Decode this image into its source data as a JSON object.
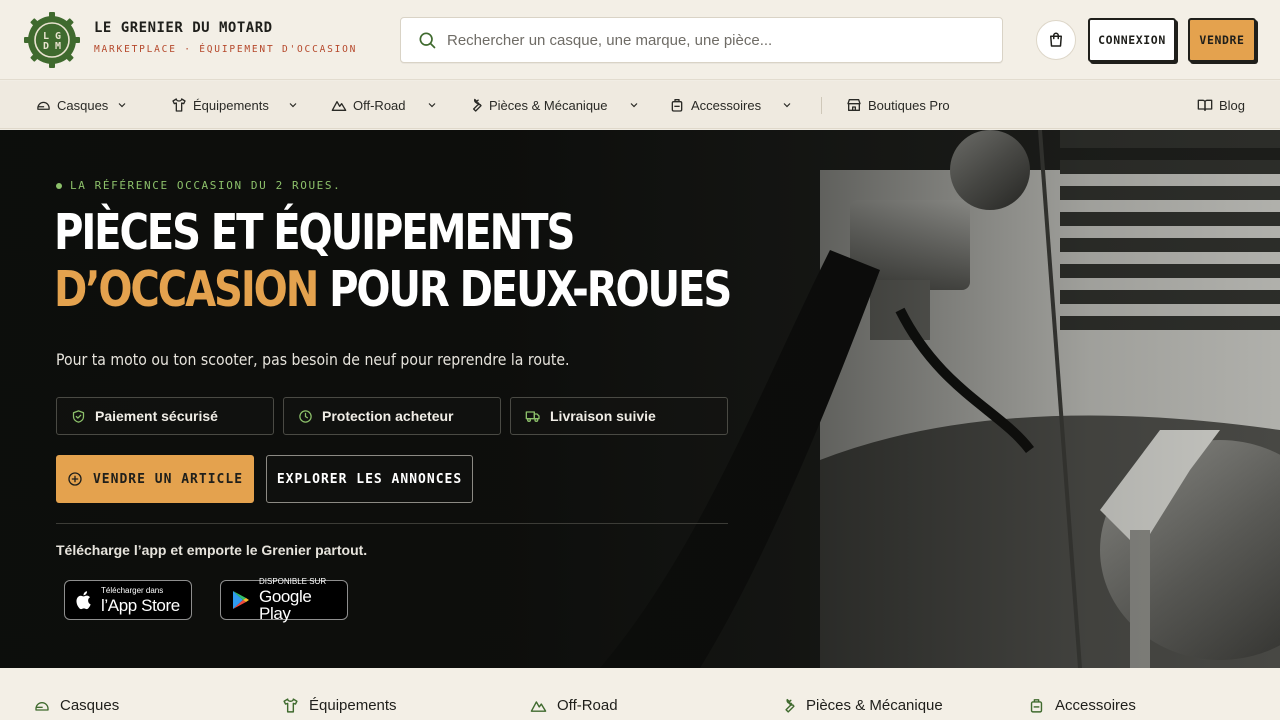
{
  "brand": {
    "name": "LE GRENIER DU MOTARD",
    "tagline": "MARKETPLACE · ÉQUIPEMENT D'OCCASION",
    "logo_letters": [
      "L",
      "G",
      "D",
      "M"
    ],
    "colors": {
      "accent": "#e4a24e",
      "green": "#3f6a2e",
      "red_tagline": "#b5482b",
      "eyebrow_green": "#8cc06a"
    }
  },
  "header": {
    "search_placeholder": "Rechercher un casque, une marque, une pièce...",
    "search_icon": "search-icon",
    "cart_icon": "shopping-bag-icon",
    "login_label": "CONNEXION",
    "sell_label": "VENDRE"
  },
  "nav": {
    "items": [
      {
        "label": "Casques",
        "icon": "helmet-icon"
      },
      {
        "label": "Équipements",
        "icon": "tshirt-icon"
      },
      {
        "label": "Off-Road",
        "icon": "mountain-icon"
      },
      {
        "label": "Pièces & Mécanique",
        "icon": "wrench-icon"
      },
      {
        "label": "Accessoires",
        "icon": "backpack-icon"
      }
    ],
    "pro_label": "Boutiques Pro",
    "blog_label": "Blog"
  },
  "hero": {
    "eyebrow": "LA RÉFÉRENCE OCCASION DU 2 ROUES.",
    "title_line1": "PIÈCES ET ÉQUIPEMENTS",
    "title_accent": "D’OCCASION",
    "title_line2_rest": " POUR DEUX-ROUES",
    "subtitle": "Pour ta moto ou ton scooter, pas besoin de neuf pour reprendre la route.",
    "features": [
      {
        "label": "Paiement sécurisé",
        "icon": "shield-check-icon"
      },
      {
        "label": "Protection acheteur",
        "icon": "clock-icon"
      },
      {
        "label": "Livraison suivie",
        "icon": "truck-icon"
      }
    ],
    "cta_sell": "VENDRE UN ARTICLE",
    "cta_explore": "EXPLORER LES ANNONCES",
    "app_text": "Télécharge l’app et emporte le Grenier partout.",
    "app_store": {
      "small": "Télécharger dans",
      "big": "l’App Store"
    },
    "google_play": {
      "small": "DISPONIBLE SUR",
      "big": "Google Play"
    }
  },
  "categories": [
    {
      "label": "Casques",
      "icon": "helmet-icon"
    },
    {
      "label": "Équipements",
      "icon": "tshirt-icon"
    },
    {
      "label": "Off-Road",
      "icon": "mountain-icon"
    },
    {
      "label": "Pièces & Mécanique",
      "icon": "wrench-icon"
    },
    {
      "label": "Accessoires",
      "icon": "backpack-icon"
    }
  ]
}
